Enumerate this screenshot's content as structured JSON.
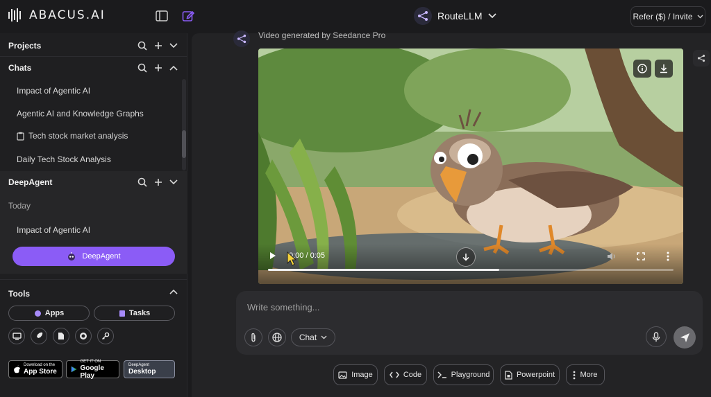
{
  "brand": {
    "name": "ABACUS.AI"
  },
  "header": {
    "model_name": "RouteLLM",
    "refer_label": "Refer ($) / Invite"
  },
  "sidebar": {
    "projects_label": "Projects",
    "chats_label": "Chats",
    "chats": [
      {
        "label": "Impact of Agentic AI"
      },
      {
        "label": "Agentic AI and Knowledge Graphs"
      },
      {
        "label": "Tech stock market analysis"
      },
      {
        "label": "Daily Tech Stock Analysis"
      }
    ],
    "deepagent_label": "DeepAgent",
    "today_label": "Today",
    "deepagent_items": [
      {
        "label": "Impact of Agentic AI"
      }
    ],
    "deepagent_button": "DeepAgent",
    "tools_label": "Tools",
    "apps_label": "Apps",
    "tasks_label": "Tasks",
    "tool_icons": [
      "monitor-icon",
      "rocket-icon",
      "document-icon",
      "github-icon",
      "key-icon"
    ],
    "stores": [
      {
        "small": "Download on the",
        "big": "App Store"
      },
      {
        "small": "GET IT ON",
        "big": "Google Play"
      },
      {
        "small": "DeepAgent",
        "big": "Desktop"
      }
    ]
  },
  "message": {
    "generated_label": "Video generated by Seedance Pro",
    "video": {
      "time": "0:00 / 0:05",
      "progress": 0.57
    }
  },
  "composer": {
    "placeholder": "Write something...",
    "mode_label": "Chat"
  },
  "tools": [
    {
      "label": "Image",
      "icon": "image-icon"
    },
    {
      "label": "Code",
      "icon": "code-icon"
    },
    {
      "label": "Playground",
      "icon": "terminal-icon"
    },
    {
      "label": "Powerpoint",
      "icon": "slides-icon"
    },
    {
      "label": "More",
      "icon": "more-vertical-icon"
    }
  ],
  "colors": {
    "accent": "#8b5cf6",
    "background": "#1b1b1d",
    "panel": "#232325"
  }
}
